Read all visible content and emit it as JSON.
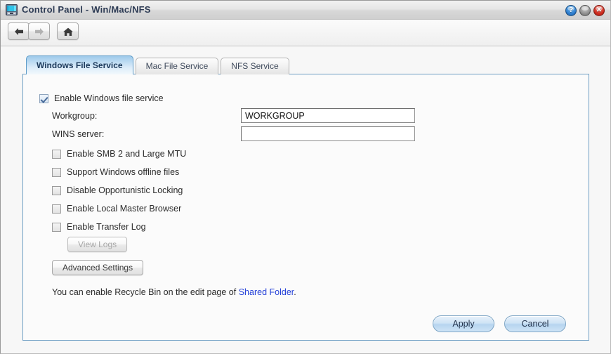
{
  "window": {
    "title": "Control Panel - Win/Mac/NFS",
    "app_icon": "control-panel-icon",
    "buttons": {
      "help": "?",
      "minimize": "",
      "close": "✕"
    }
  },
  "toolbar": {
    "back": "back-arrow-icon",
    "forward": "forward-arrow-icon",
    "home": "home-icon"
  },
  "tabs": [
    {
      "label": "Windows File Service",
      "active": true
    },
    {
      "label": "Mac File Service",
      "active": false
    },
    {
      "label": "NFS Service",
      "active": false
    }
  ],
  "form": {
    "enable_service": {
      "label": "Enable Windows file service",
      "checked": true
    },
    "fields": [
      {
        "label": "Workgroup:",
        "value": "WORKGROUP",
        "placeholder": ""
      },
      {
        "label": "WINS server:",
        "value": "",
        "placeholder": ""
      }
    ],
    "options": [
      {
        "label": "Enable SMB 2 and Large MTU",
        "checked": false
      },
      {
        "label": "Support Windows offline files",
        "checked": false
      },
      {
        "label": "Disable Opportunistic Locking",
        "checked": false
      },
      {
        "label": "Enable Local Master Browser",
        "checked": false
      },
      {
        "label": "Enable Transfer Log",
        "checked": false
      }
    ],
    "view_logs_label": "View Logs",
    "advanced_settings_label": "Advanced Settings",
    "note": {
      "before": "You can enable Recycle Bin on the edit page of ",
      "link": "Shared Folder",
      "after": "."
    }
  },
  "footer": {
    "apply_label": "Apply",
    "cancel_label": "Cancel"
  },
  "colors": {
    "accent": "#6f9fc4",
    "link": "#2541d8",
    "title_text": "#2d3b54",
    "close": "#cf2d20",
    "help": "#2f7fd0"
  }
}
